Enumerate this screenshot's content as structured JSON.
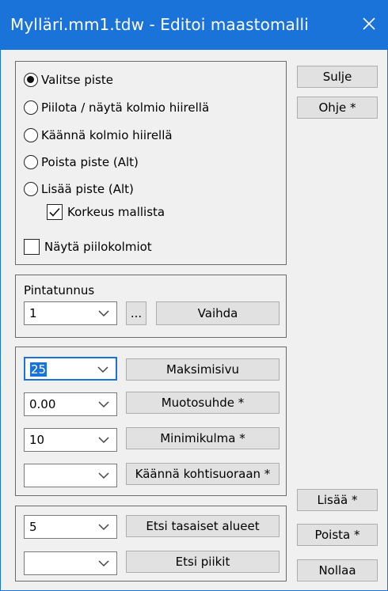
{
  "window": {
    "title": "Mylläri.mm1.tdw - Editoi maastomalli"
  },
  "mode_group": {
    "options": [
      {
        "label": "Valitse piste",
        "checked": true
      },
      {
        "label": "Piilota / näytä kolmio hiirellä",
        "checked": false
      },
      {
        "label": "Käännä kolmio hiirellä",
        "checked": false
      },
      {
        "label": "Poista piste (Alt)",
        "checked": false
      },
      {
        "label": "Lisää piste (Alt)",
        "checked": false
      }
    ],
    "korkeus_mallista": {
      "label": "Korkeus mallista",
      "checked": true
    },
    "nayta_piilokolmiot": {
      "label": "Näytä piilokolmiot",
      "checked": false
    }
  },
  "pintatunnus": {
    "label": "Pintatunnus",
    "value": "1",
    "browse_label": "...",
    "change_label": "Vaihda"
  },
  "params": {
    "maksimisivu": {
      "value": "25",
      "button": "Maksimisivu"
    },
    "muotosuhde": {
      "value": "0.00",
      "button": "Muotosuhde *"
    },
    "minimikulma": {
      "value": "10",
      "button": "Minimikulma *"
    },
    "kaanna": {
      "value": "",
      "button": "Käännä kohtisuoraan *"
    }
  },
  "search": {
    "tasaiset": {
      "value": "5",
      "button": "Etsi tasaiset alueet"
    },
    "piikit": {
      "value": "",
      "button": "Etsi piikit"
    }
  },
  "side_buttons": {
    "close": "Sulje",
    "help": "Ohje *",
    "add": "Lisää *",
    "remove": "Poista *",
    "reset": "Nollaa"
  },
  "colors": {
    "titlebar": "#1a73d9",
    "dialog_bg": "#f0f0f0",
    "button_bg": "#e1e1e1"
  }
}
